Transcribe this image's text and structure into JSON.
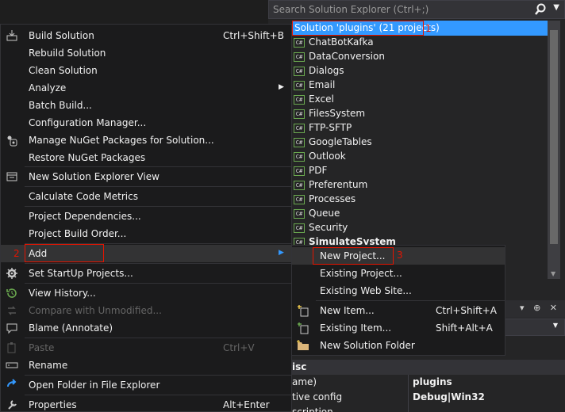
{
  "solution_explorer": {
    "search_placeholder": "Search Solution Explorer (Ctrl+;)",
    "solution_label": "Solution 'plugins' (21 projects)",
    "annotation_1": "1",
    "projects": [
      "ChatBotKafka",
      "DataConversion",
      "Dialogs",
      "Email",
      "Excel",
      "FilesSystem",
      "FTP-SFTP",
      "GoogleTables",
      "Outlook",
      "PDF",
      "Preferentum",
      "Processes",
      "Queue",
      "Security",
      "SimulateSystem"
    ],
    "project_badge": "C#"
  },
  "properties": {
    "toolbar": "▾ ⊕ ✕",
    "category": "isc",
    "rows": [
      {
        "name": "ame)",
        "value": "plugins"
      },
      {
        "name": "tive config",
        "value": "Debug|Win32"
      },
      {
        "name": "scription",
        "value": ""
      }
    ]
  },
  "menu": {
    "build_solution": "Build Solution",
    "build_solution_shortcut": "Ctrl+Shift+B",
    "rebuild_solution": "Rebuild Solution",
    "clean_solution": "Clean Solution",
    "analyze": "Analyze",
    "batch_build": "Batch Build...",
    "configuration_manager": "Configuration Manager...",
    "manage_nuget": "Manage NuGet Packages for Solution...",
    "restore_nuget": "Restore NuGet Packages",
    "new_se_view": "New Solution Explorer View",
    "calc_metrics": "Calculate Code Metrics",
    "project_dependencies": "Project Dependencies...",
    "project_build_order": "Project Build Order...",
    "add": "Add",
    "annotation_2": "2",
    "set_startup": "Set StartUp Projects...",
    "view_history": "View History...",
    "compare_unmodified": "Compare with Unmodified...",
    "blame": "Blame (Annotate)",
    "paste": "Paste",
    "paste_shortcut": "Ctrl+V",
    "rename": "Rename",
    "open_folder": "Open Folder in File Explorer",
    "properties": "Properties",
    "properties_shortcut": "Alt+Enter"
  },
  "submenu": {
    "new_project": "New Project...",
    "annotation_3": "3",
    "existing_project": "Existing Project...",
    "existing_website": "Existing Web Site...",
    "new_item": "New Item...",
    "new_item_shortcut": "Ctrl+Shift+A",
    "existing_item": "Existing Item...",
    "existing_item_shortcut": "Shift+Alt+A",
    "new_solution_folder": "New Solution Folder"
  },
  "colors": {
    "selection": "#3399ff",
    "annotation_red": "#e51400",
    "menu_bg": "#1b1b1c",
    "csharp_green": "#6aa84f"
  }
}
